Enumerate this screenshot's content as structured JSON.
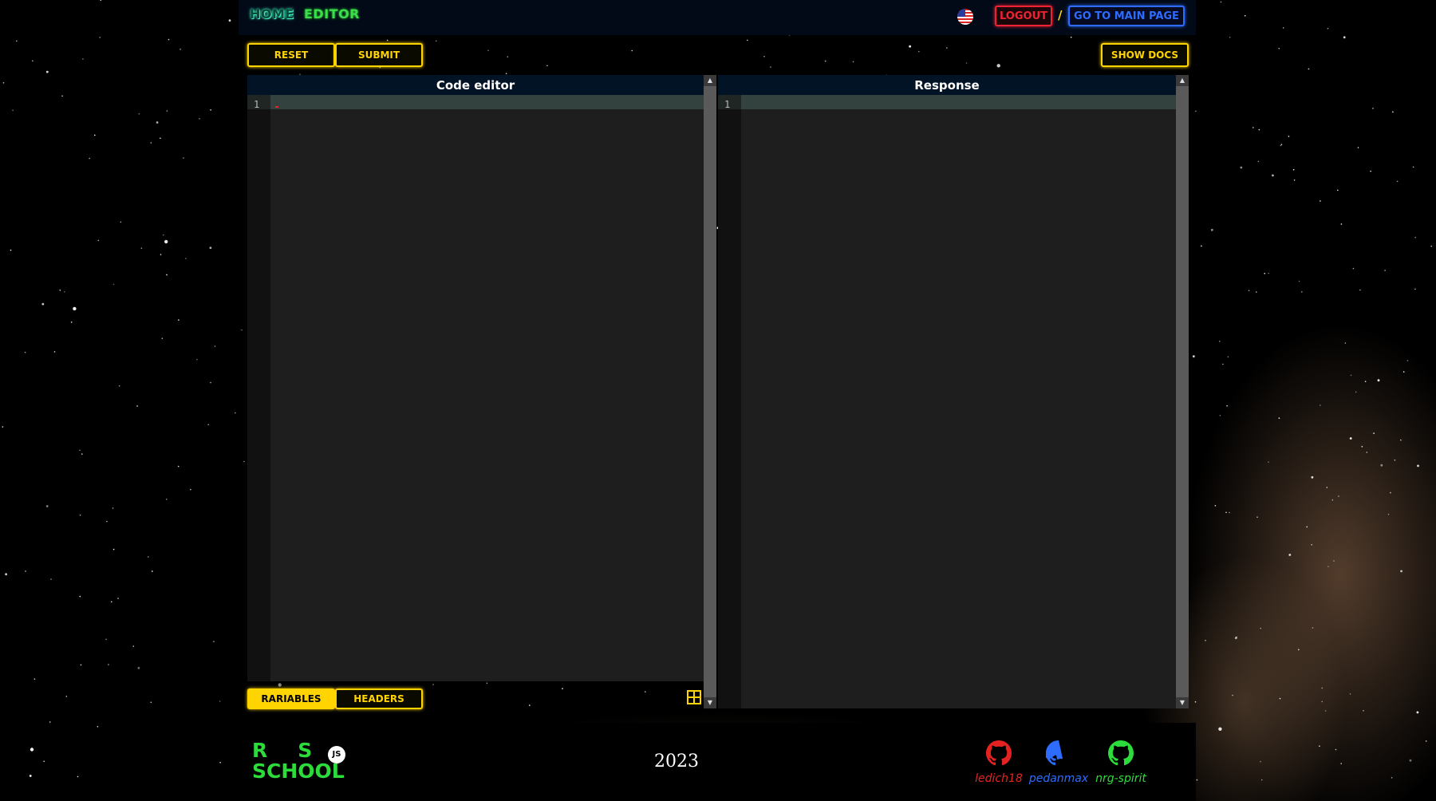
{
  "header": {
    "nav": {
      "home": "Home",
      "editor": "Editor"
    },
    "language_icon": "us-flag-icon",
    "logout_label": "Logout",
    "separator": "/",
    "main_page_label": "Go to main page"
  },
  "toolbar": {
    "reset_label": "Reset",
    "submit_label": "Submit",
    "docs_label": "Show docs"
  },
  "editor": {
    "title": "Code editor",
    "line_number": "1"
  },
  "response": {
    "title": "Response",
    "line_number": "1"
  },
  "bottom_tabs": {
    "variables_label": "Rariables",
    "headers_label": "Headers"
  },
  "footer": {
    "logo_line1": "RS",
    "logo_line2": "SCHOOL",
    "logo_badge": "JS",
    "year": "2023",
    "authors": [
      {
        "name": "ledich18",
        "color": "#e52222"
      },
      {
        "name": "pedanmax",
        "color": "#2d6cff"
      },
      {
        "name": "nrg-spirit",
        "color": "#2bdc3a"
      }
    ]
  },
  "colors": {
    "accent_yellow": "#ffd400",
    "logout_red": "#ee2233",
    "main_blue": "#2d6cff",
    "nav_green": "#3ddc4a"
  }
}
